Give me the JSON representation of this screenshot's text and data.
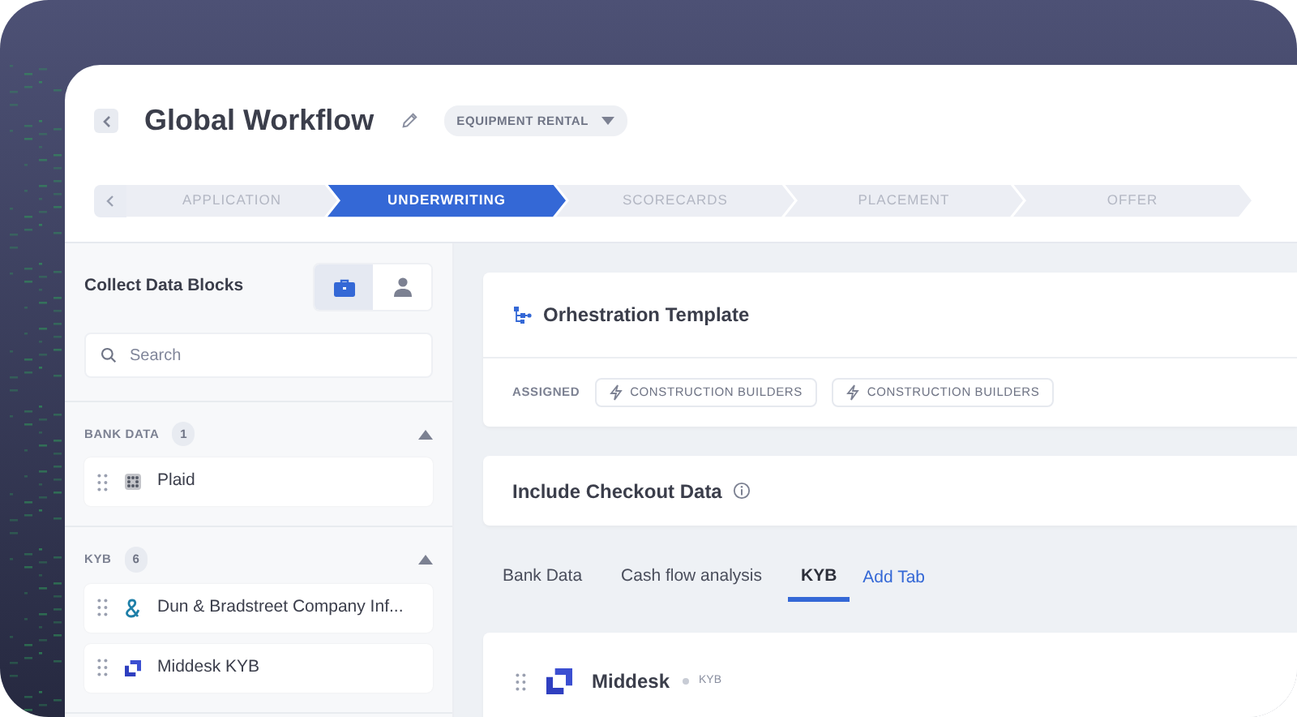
{
  "header": {
    "title": "Global Workflow",
    "tag": "EQUIPMENT RENTAL"
  },
  "steps": [
    {
      "label": "APPLICATION",
      "selected": false
    },
    {
      "label": "UNDERWRITING",
      "selected": true
    },
    {
      "label": "SCORECARDS",
      "selected": false
    },
    {
      "label": "PLACEMENT",
      "selected": false
    },
    {
      "label": "OFFER",
      "selected": false
    }
  ],
  "sidebar": {
    "title": "Collect Data Blocks",
    "view_toggle": [
      {
        "kind": "business",
        "selected": true
      },
      {
        "kind": "person",
        "selected": false
      }
    ],
    "search": {
      "placeholder": "Search"
    },
    "sections": [
      {
        "name": "BANK DATA",
        "count": "1",
        "expanded": true,
        "items": [
          {
            "name": "Plaid",
            "kind": "plaid"
          }
        ]
      },
      {
        "name": "KYB",
        "count": "6",
        "expanded": true,
        "items": [
          {
            "name": "Dun & Bradstreet Company Inf...",
            "kind": "dnb"
          },
          {
            "name": "Middesk KYB",
            "kind": "middesk"
          }
        ]
      }
    ]
  },
  "orchestration": {
    "title": "Orhestration Template",
    "assigned_label": "ASSIGNED",
    "chips": [
      "CONSTRUCTION BUILDERS",
      "CONSTRUCTION BUILDERS"
    ]
  },
  "checkout": {
    "title": "Include Checkout Data"
  },
  "tabs": [
    {
      "label": "Bank Data",
      "selected": false
    },
    {
      "label": "Cash flow analysis",
      "selected": false
    },
    {
      "label": "KYB",
      "selected": true
    }
  ],
  "add_tab": "Add Tab",
  "block": {
    "name": "Middesk",
    "category": "KYB",
    "kind": "middesk"
  }
}
